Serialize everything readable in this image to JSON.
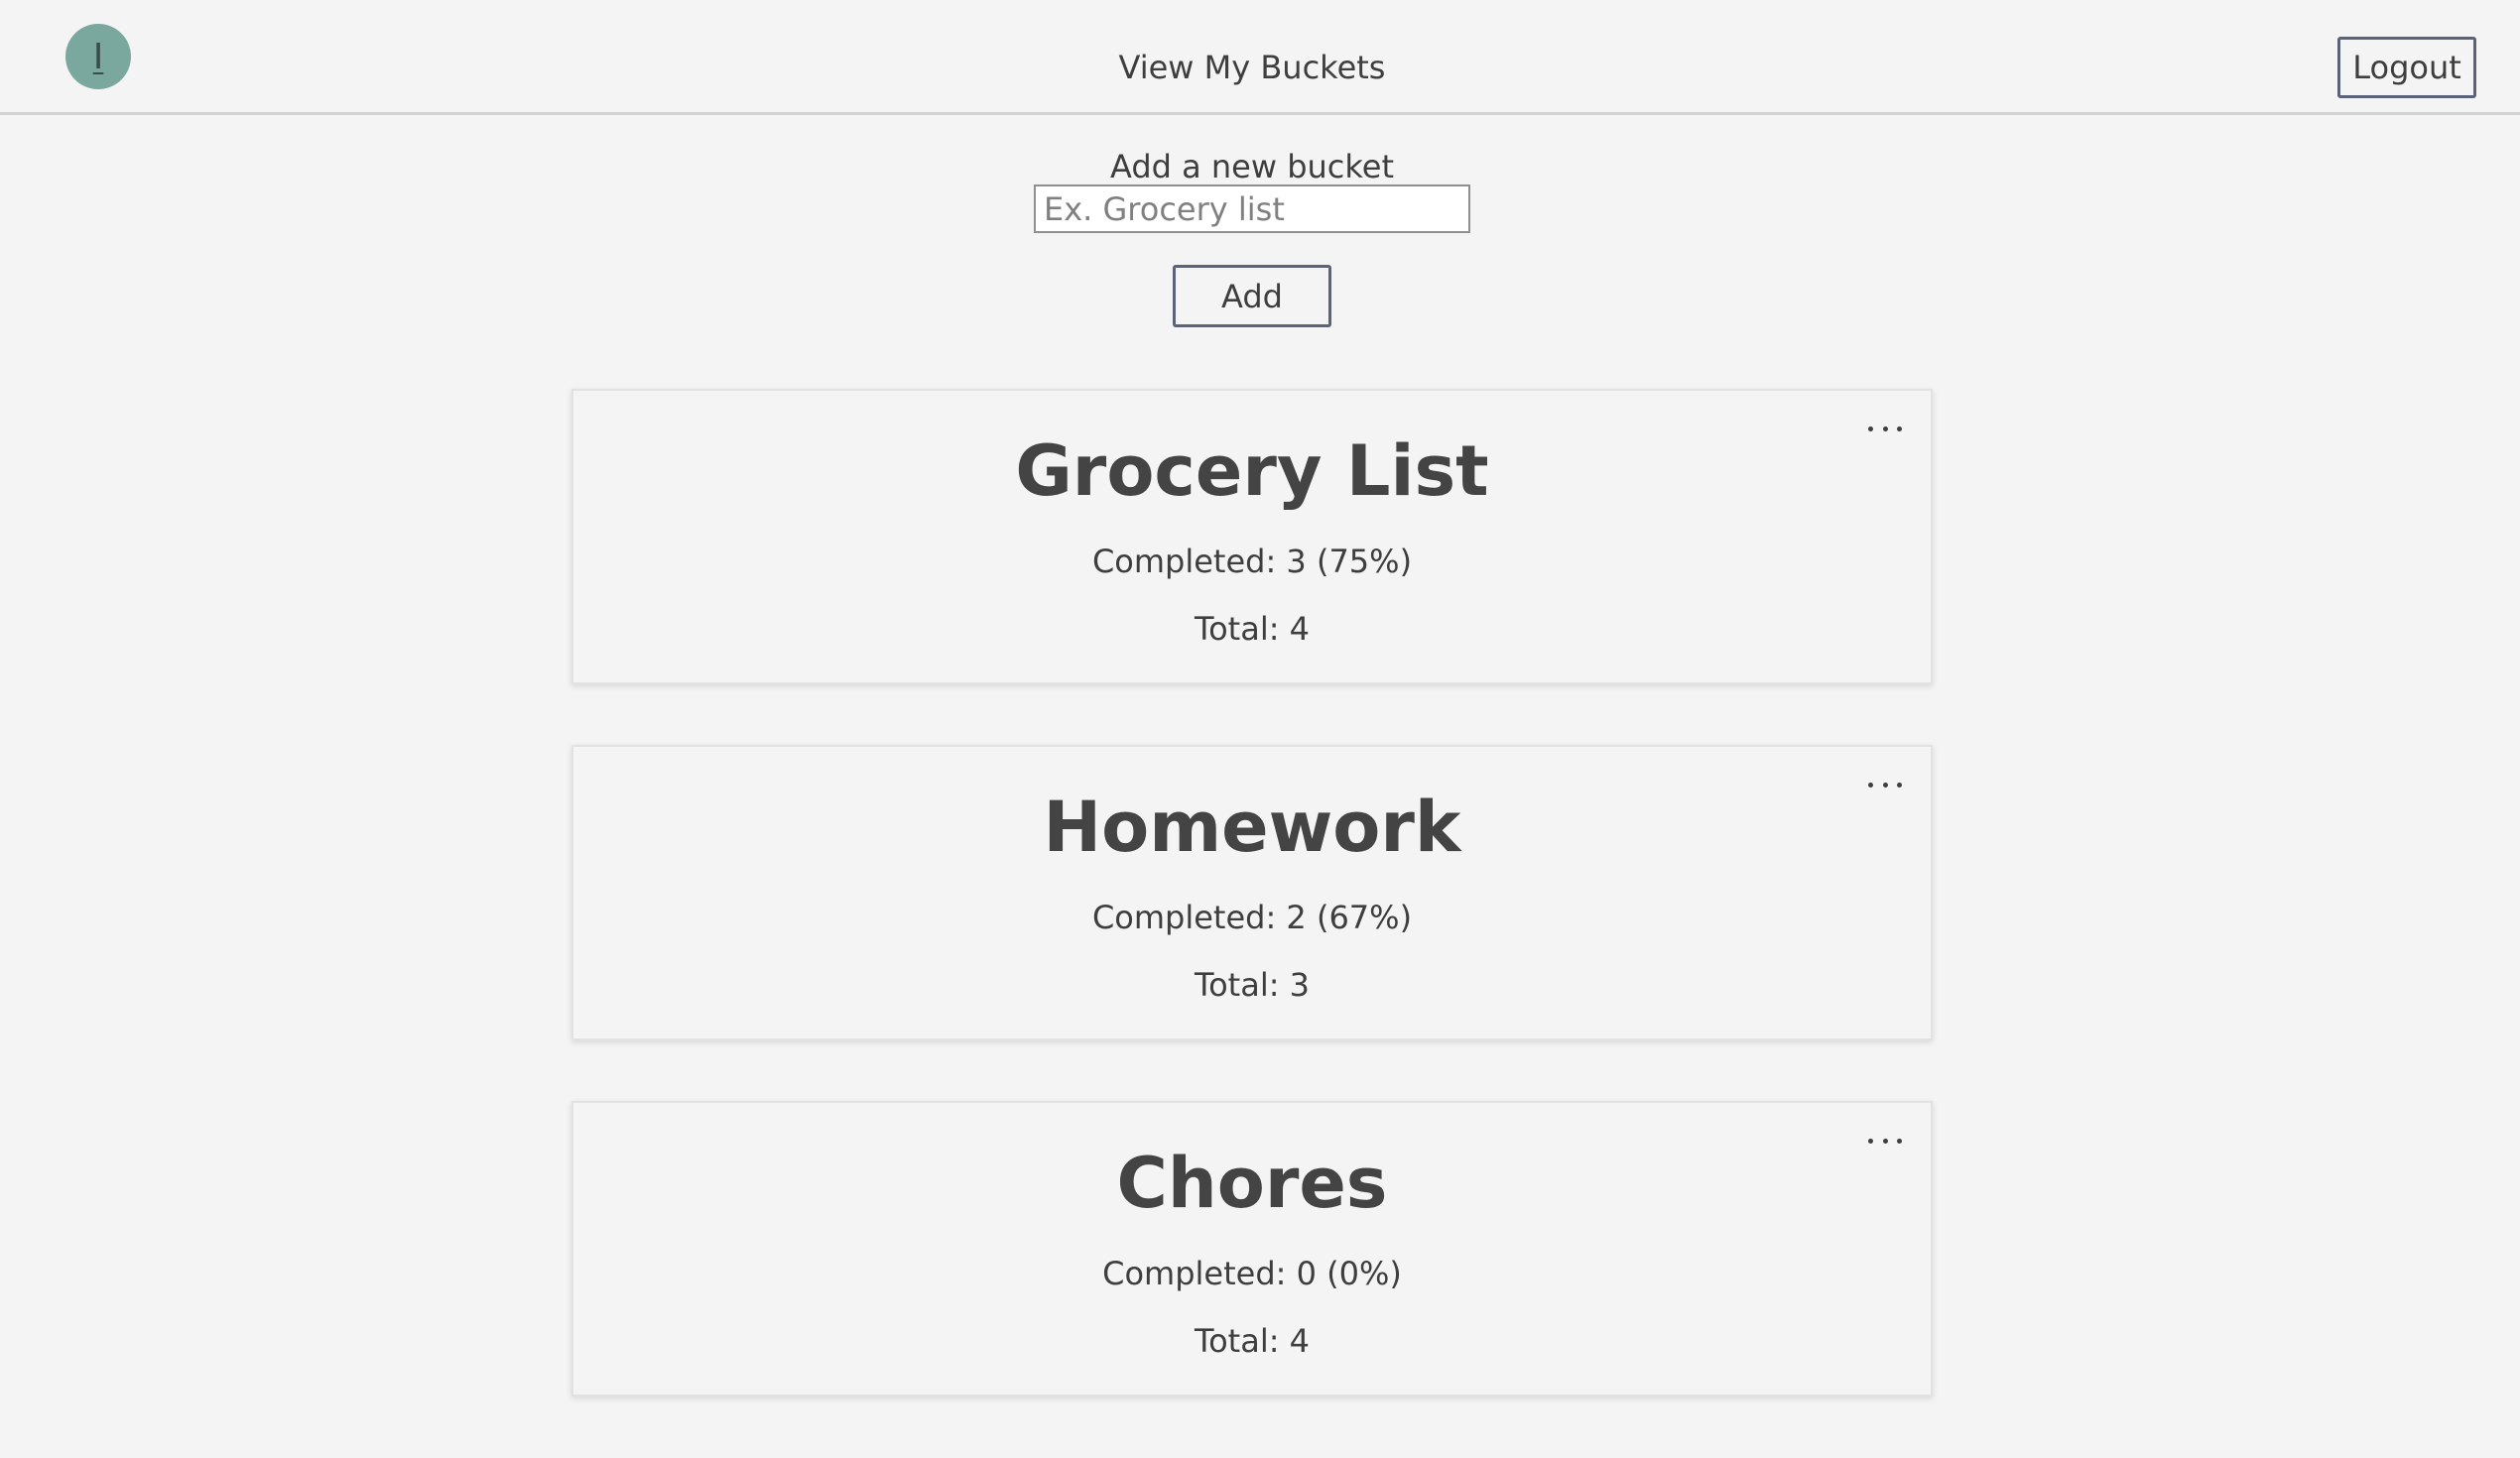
{
  "header": {
    "avatar_initial": "I",
    "title": "View My Buckets",
    "logout_label": "Logout"
  },
  "add_bucket": {
    "label": "Add a new bucket",
    "placeholder": "Ex. Grocery list",
    "value": "",
    "button_label": "Add"
  },
  "buckets": [
    {
      "title": "Grocery List",
      "completed": "Completed: 3 (75%)",
      "total": "Total: 4",
      "menu_icon": "more-horizontal-icon"
    },
    {
      "title": "Homework",
      "completed": "Completed: 2 (67%)",
      "total": "Total: 3",
      "menu_icon": "more-horizontal-icon"
    },
    {
      "title": "Chores",
      "completed": "Completed: 0 (0%)",
      "total": "Total: 4",
      "menu_icon": "more-horizontal-icon"
    }
  ],
  "colors": {
    "background": "#f4f4f4",
    "avatar": "#7aa89f",
    "button_border": "#5a6378"
  }
}
